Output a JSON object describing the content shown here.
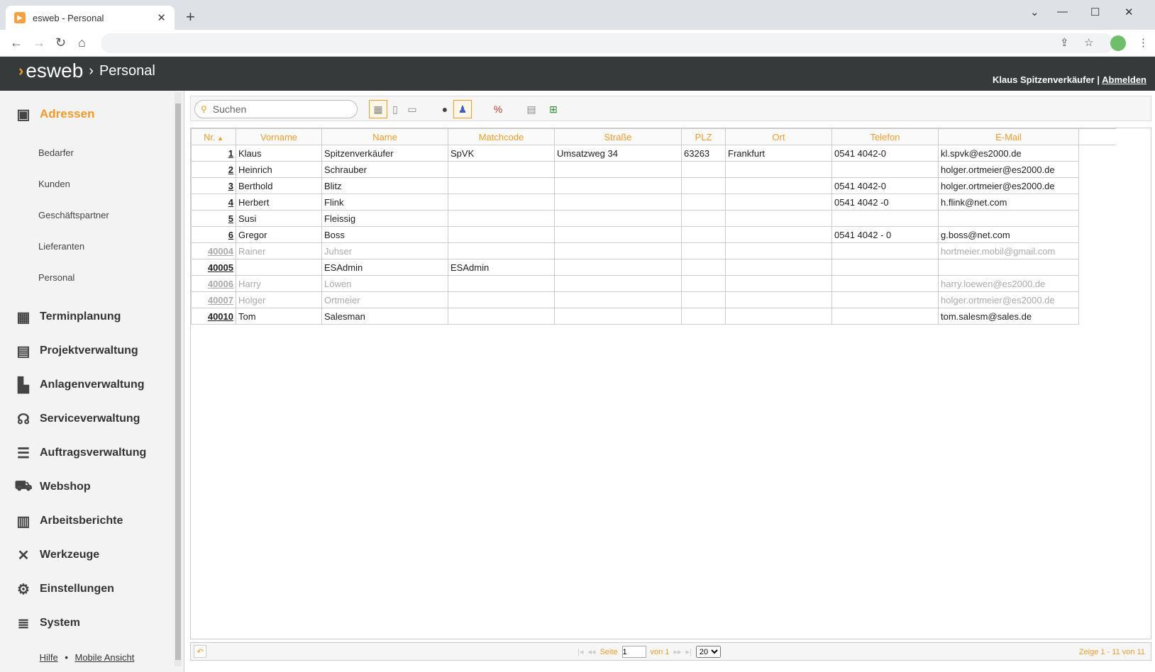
{
  "browser": {
    "tab_title": "esweb - Personal",
    "tab_close": "✕",
    "new_tab": "+"
  },
  "app": {
    "logo": "esweb",
    "breadcrumb": "Personal",
    "user_name": "Klaus Spitzenverkäufer",
    "separator": "|",
    "logout": "Abmelden"
  },
  "sidebar": {
    "active_module": "Adressen",
    "subitems": [
      "Bedarfer",
      "Kunden",
      "Geschäftspartner",
      "Lieferanten",
      "Personal"
    ],
    "modules": [
      "Terminplanung",
      "Projektverwaltung",
      "Anlagenverwaltung",
      "Serviceverwaltung",
      "Auftragsverwaltung",
      "Webshop",
      "Arbeitsberichte",
      "Werkzeuge",
      "Einstellungen",
      "System"
    ],
    "footer_help": "Hilfe",
    "footer_dot": "•",
    "footer_mobile": "Mobile Ansicht"
  },
  "toolbar": {
    "search_placeholder": "Suchen"
  },
  "table": {
    "columns": [
      "Nr.",
      "Vorname",
      "Name",
      "Matchcode",
      "Straße",
      "PLZ",
      "Ort",
      "Telefon",
      "E-Mail"
    ],
    "rows": [
      {
        "nr": "1",
        "vorname": "Klaus",
        "name": "Spitzenverkäufer",
        "matchcode": "SpVK",
        "strasse": "Umsatzweg 34",
        "plz": "63263",
        "ort": "Frankfurt",
        "telefon": "0541 4042-0",
        "email": "kl.spvk@es2000.de",
        "dim": false
      },
      {
        "nr": "2",
        "vorname": "Heinrich",
        "name": "Schrauber",
        "matchcode": "",
        "strasse": "",
        "plz": "",
        "ort": "",
        "telefon": "",
        "email": "holger.ortmeier@es2000.de",
        "dim": false
      },
      {
        "nr": "3",
        "vorname": "Berthold",
        "name": "Blitz",
        "matchcode": "",
        "strasse": "",
        "plz": "",
        "ort": "",
        "telefon": "0541 4042-0",
        "email": "holger.ortmeier@es2000.de",
        "dim": false
      },
      {
        "nr": "4",
        "vorname": "Herbert",
        "name": "Flink",
        "matchcode": "",
        "strasse": "",
        "plz": "",
        "ort": "",
        "telefon": "0541 4042 -0",
        "email": "h.flink@net.com",
        "dim": false
      },
      {
        "nr": "5",
        "vorname": "Susi",
        "name": "Fleissig",
        "matchcode": "",
        "strasse": "",
        "plz": "",
        "ort": "",
        "telefon": "",
        "email": "",
        "dim": false
      },
      {
        "nr": "6",
        "vorname": "Gregor",
        "name": "Boss",
        "matchcode": "",
        "strasse": "",
        "plz": "",
        "ort": "",
        "telefon": "0541 4042 - 0",
        "email": "g.boss@net.com",
        "dim": false
      },
      {
        "nr": "40004",
        "vorname": "Rainer",
        "name": "Juhser",
        "matchcode": "",
        "strasse": "",
        "plz": "",
        "ort": "",
        "telefon": "",
        "email": "hortmeier.mobil@gmail.com",
        "dim": true
      },
      {
        "nr": "40005",
        "vorname": "",
        "name": "ESAdmin",
        "matchcode": "ESAdmin",
        "strasse": "",
        "plz": "",
        "ort": "",
        "telefon": "",
        "email": "",
        "dim": false
      },
      {
        "nr": "40006",
        "vorname": "Harry",
        "name": "Löwen",
        "matchcode": "",
        "strasse": "",
        "plz": "",
        "ort": "",
        "telefon": "",
        "email": "harry.loewen@es2000.de",
        "dim": true
      },
      {
        "nr": "40007",
        "vorname": "Holger",
        "name": "Ortmeier",
        "matchcode": "",
        "strasse": "",
        "plz": "",
        "ort": "",
        "telefon": "",
        "email": "holger.ortmeier@es2000.de",
        "dim": true
      },
      {
        "nr": "40010",
        "vorname": "Tom",
        "name": "Salesman",
        "matchcode": "",
        "strasse": "",
        "plz": "",
        "ort": "",
        "telefon": "",
        "email": "tom.salesm@sales.de",
        "dim": false
      }
    ]
  },
  "pager": {
    "page_label": "Seite",
    "page_value": "1",
    "of_label": "von 1",
    "page_size": "20",
    "info": "Zeige 1 - 11 von 11"
  },
  "colors": {
    "accent": "#f39a2a",
    "header_bg": "#363a3b"
  }
}
